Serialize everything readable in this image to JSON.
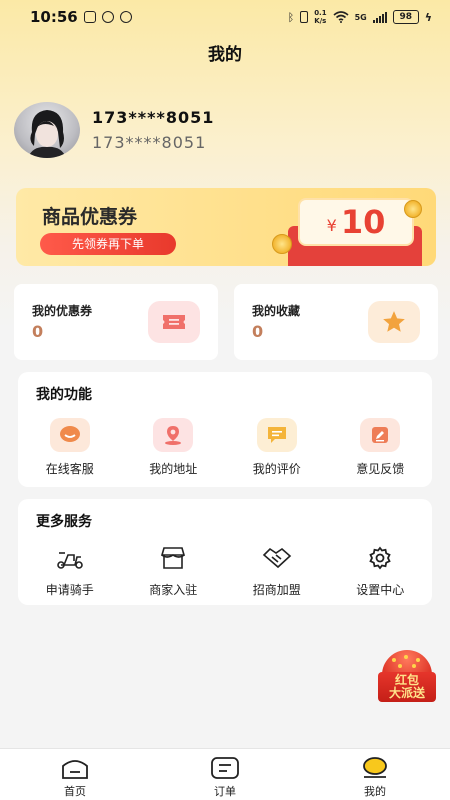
{
  "status_bar": {
    "time": "10:56",
    "battery": "98",
    "network": "5G",
    "speed_top": "0.1",
    "speed_bottom": "K/s"
  },
  "page": {
    "title": "我的"
  },
  "profile": {
    "name": "173****8051",
    "phone": "173****8051"
  },
  "coupon_banner": {
    "title": "商品优惠券",
    "button": "先领券再下单",
    "currency": "¥",
    "amount": "10"
  },
  "stats": [
    {
      "label": "我的优惠券",
      "value": "0",
      "icon": "ticket-icon"
    },
    {
      "label": "我的收藏",
      "value": "0",
      "icon": "star-icon"
    }
  ],
  "functions": {
    "title": "我的功能",
    "items": [
      {
        "label": "在线客服",
        "icon": "chat-icon"
      },
      {
        "label": "我的地址",
        "icon": "location-icon"
      },
      {
        "label": "我的评价",
        "icon": "comment-icon"
      },
      {
        "label": "意见反馈",
        "icon": "edit-icon"
      }
    ]
  },
  "services": {
    "title": "更多服务",
    "items": [
      {
        "label": "申请骑手",
        "icon": "scooter-icon"
      },
      {
        "label": "商家入驻",
        "icon": "store-icon"
      },
      {
        "label": "招商加盟",
        "icon": "handshake-icon"
      },
      {
        "label": "设置中心",
        "icon": "settings-icon"
      }
    ]
  },
  "float_badge": {
    "line1": "红包",
    "line2": "大派送"
  },
  "bottom_nav": [
    {
      "label": "首页",
      "icon": "home-icon",
      "active": false
    },
    {
      "label": "订单",
      "icon": "order-icon",
      "active": false
    },
    {
      "label": "我的",
      "icon": "profile-icon",
      "active": true
    }
  ],
  "colors": {
    "accent_yellow": "#f8c81c",
    "coupon_red": "#e84233",
    "stat_value": "#c37f5c"
  }
}
